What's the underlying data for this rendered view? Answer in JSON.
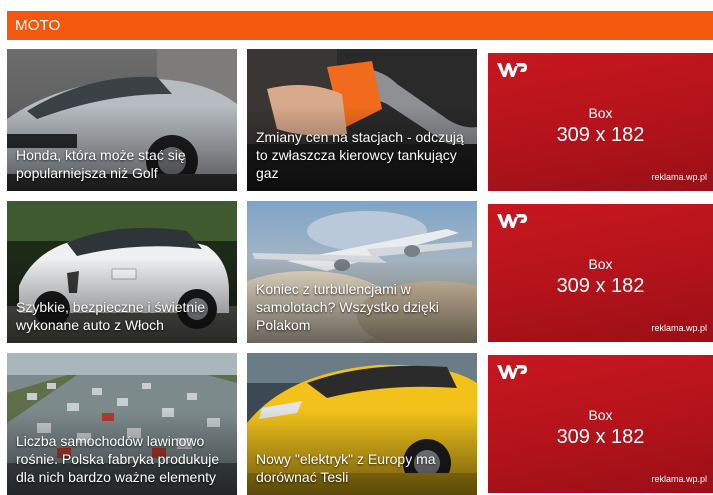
{
  "section": {
    "title": "MOTO"
  },
  "articles": [
    {
      "caption": "Honda, która może stać się popularniejsza niż Golf"
    },
    {
      "caption": "Zmiany cen na stacjach - odczują to zwłaszcza kierowcy tankujący gaz"
    },
    {
      "caption": "Szybkie, bezpieczne i świetnie wykonane auto z Włoch"
    },
    {
      "caption": "Koniec z turbulencjami w samolotach? Wszystko dzięki Polakom"
    },
    {
      "caption": "Liczba samochodów lawinowo rośnie. Polska fabryka produkuje dla nich bardzo ważne elementy"
    },
    {
      "caption": "Nowy \"elektryk\" z Europy ma dorównać Tesli"
    }
  ],
  "ads": [
    {
      "box_label": "Box",
      "size": "309 x 182",
      "domain": "reklama.wp.pl",
      "logo_icon": "wp-logo-icon"
    },
    {
      "box_label": "Box",
      "size": "309 x 182",
      "domain": "reklama.wp.pl",
      "logo_icon": "wp-logo-icon"
    },
    {
      "box_label": "Box",
      "size": "309 x 182",
      "domain": "reklama.wp.pl",
      "logo_icon": "wp-logo-icon"
    }
  ],
  "colors": {
    "accent": "#f4580e",
    "ad_red": "#c8171f"
  }
}
